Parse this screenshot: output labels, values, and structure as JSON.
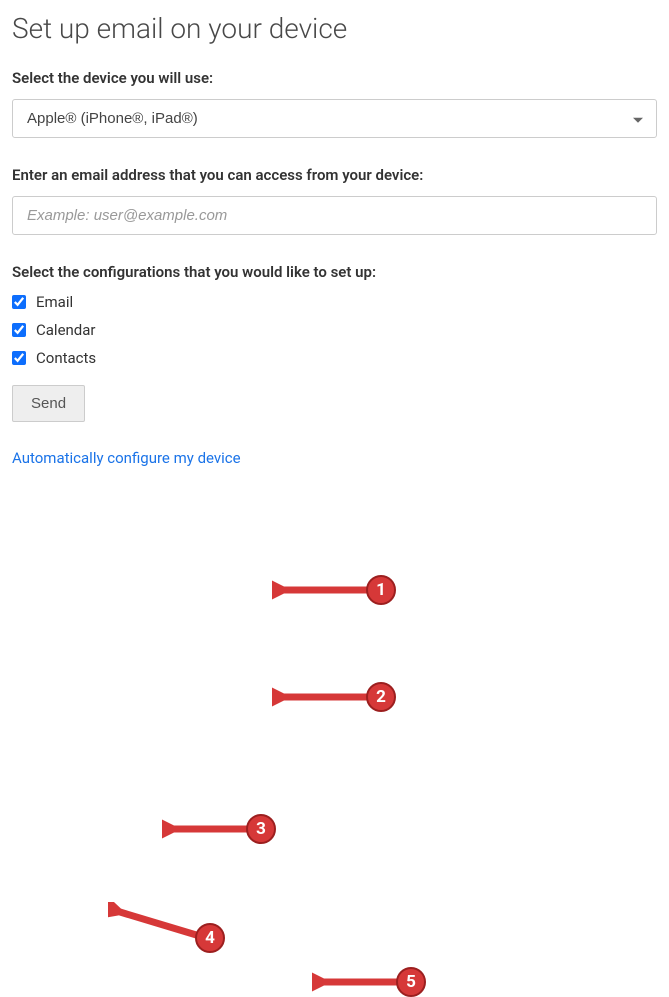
{
  "title": "Set up email on your device",
  "device_section": {
    "label": "Select the device you will use:",
    "selected": "Apple® (iPhone®, iPad®)"
  },
  "email_section": {
    "label": "Enter an email address that you can access from your device:",
    "placeholder": "Example: user@example.com",
    "value": ""
  },
  "config_section": {
    "label": "Select the configurations that you would like to set up:",
    "options": [
      {
        "label": "Email",
        "checked": true
      },
      {
        "label": "Calendar",
        "checked": true
      },
      {
        "label": "Contacts",
        "checked": true
      }
    ]
  },
  "send_button": "Send",
  "auto_link": "Automatically configure my device",
  "annotations": [
    "1",
    "2",
    "3",
    "4",
    "5"
  ]
}
